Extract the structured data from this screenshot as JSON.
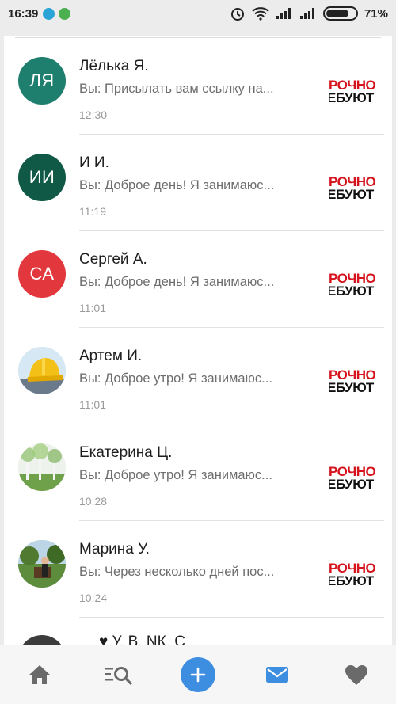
{
  "status_bar": {
    "time": "16:39",
    "battery_percent": "71%",
    "battery_level": 0.71
  },
  "colors": {
    "accent": "#3d8de0",
    "avatar_li": "#1e7f6e",
    "avatar_ii": "#0f5946",
    "avatar_sa": "#e2383d",
    "ad_red": "#d6131c"
  },
  "conversations": [
    {
      "initials": "ЛЯ",
      "name": "Лёлька Я.",
      "preview": "Вы: Присылать вам ссылку на...",
      "time": "12:30",
      "ad_line1": "РОЧНО",
      "ad_line2": "ЕБУЮТ",
      "avatar_color": "#1e7f6e"
    },
    {
      "initials": "ИИ",
      "name": "И И.",
      "preview": "Вы: Доброе день!  Я занимаюс...",
      "time": "11:19",
      "ad_line1": "РОЧНО",
      "ad_line2": "ЕБУЮТ",
      "avatar_color": "#0f5946"
    },
    {
      "initials": "СА",
      "name": "Сергей А.",
      "preview": "Вы: Доброе день!  Я занимаюс...",
      "time": "11:01",
      "ad_line1": "РОЧНО",
      "ad_line2": "ЕБУЮТ",
      "avatar_color": "#e2383d"
    },
    {
      "initials": "",
      "name": "Артем И.",
      "preview": "Вы: Доброе утро!  Я занимаюс...",
      "time": "11:01",
      "ad_line1": "РОЧНО",
      "ad_line2": "ЕБУЮТ",
      "avatar_icon": "hard-hat-photo"
    },
    {
      "initials": "",
      "name": "Екатерина Ц.",
      "preview": "Вы: Доброе утро!  Я занимаюс...",
      "time": "10:28",
      "ad_line1": "РОЧНО",
      "ad_line2": "ЕБУЮТ",
      "avatar_icon": "birch-trees-photo"
    },
    {
      "initials": "",
      "name": "Марина У.",
      "preview": "Вы: Через несколько дней пос...",
      "time": "10:24",
      "ad_line1": "РОЧНО",
      "ad_line2": "ЕБУЮТ",
      "avatar_icon": "person-outdoor-photo"
    }
  ],
  "partial_row": {
    "name": "♥ У. В. NК. С"
  },
  "bottom_nav": {
    "items": [
      {
        "icon": "home-icon"
      },
      {
        "icon": "search-list-icon"
      },
      {
        "icon": "add-icon"
      },
      {
        "icon": "mail-icon"
      },
      {
        "icon": "heart-icon"
      }
    ]
  }
}
